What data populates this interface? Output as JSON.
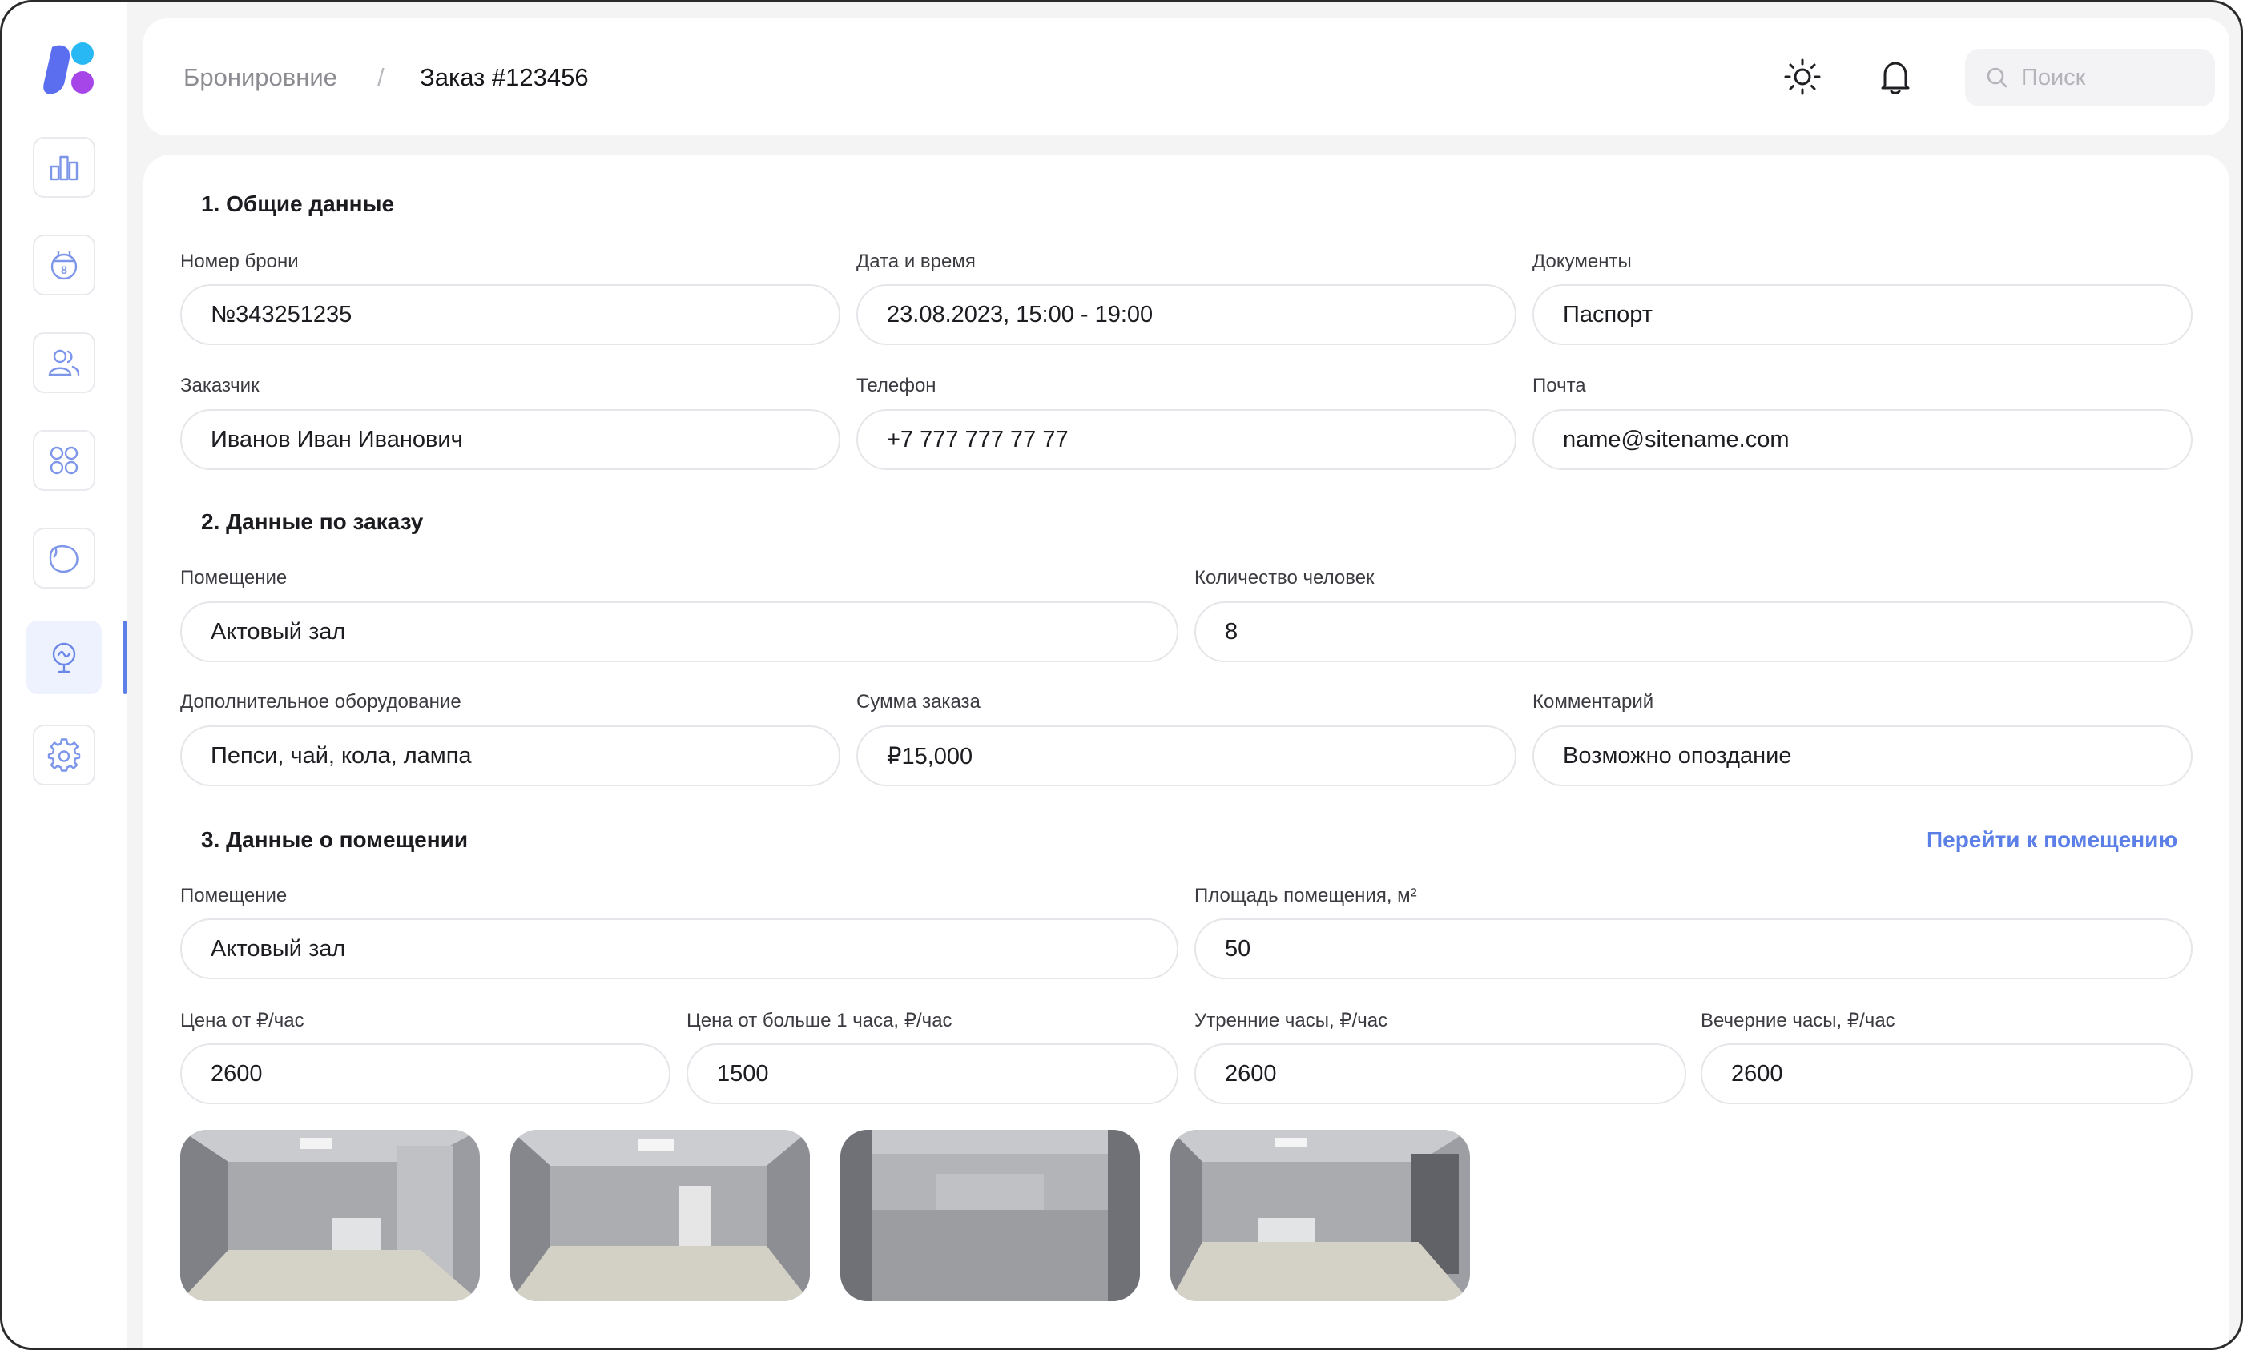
{
  "header": {
    "breadcrumb_root": "Бронировние",
    "breadcrumb_separator": "/",
    "breadcrumb_current": "Заказ #123456",
    "search_placeholder": "Поиск"
  },
  "sidebar": {
    "items": [
      {
        "icon": "bar-chart-icon"
      },
      {
        "icon": "calendar-icon",
        "badge": "8"
      },
      {
        "icon": "users-icon"
      },
      {
        "icon": "grid-icon"
      },
      {
        "icon": "blob-icon"
      },
      {
        "icon": "presentation-icon",
        "active": true
      },
      {
        "icon": "gear-icon"
      }
    ],
    "accent_color": "#5d7fe8"
  },
  "section1": {
    "title": "1. Общие данные",
    "fields": {
      "booking_number": {
        "label": "Номер брони",
        "value": "№343251235"
      },
      "datetime": {
        "label": "Дата и время",
        "value": "23.08.2023, 15:00 - 19:00"
      },
      "documents": {
        "label": "Документы",
        "value": "Паспорт"
      },
      "customer": {
        "label": "Заказчик",
        "value": "Иванов Иван Иванович"
      },
      "phone": {
        "label": "Телефон",
        "value": "+7 777 777 77 77"
      },
      "email": {
        "label": "Почта",
        "value": "name@sitename.com"
      }
    }
  },
  "section2": {
    "title": "2. Данные по заказу",
    "fields": {
      "room": {
        "label": "Помещение",
        "value": "Актовый зал"
      },
      "people": {
        "label": "Количество человек",
        "value": "8"
      },
      "equipment": {
        "label": "Дополнительное оборудование",
        "value": "Пепси, чай, кола, лампа"
      },
      "sum": {
        "label": "Сумма заказа",
        "value": "₽15,000"
      },
      "comment": {
        "label": "Комментарий",
        "value": "Возможно опоздание"
      }
    }
  },
  "section3": {
    "title": "3. Данные о помещении",
    "link_label": "Перейти к помещению",
    "fields": {
      "room": {
        "label": "Помещение",
        "value": "Актовый зал"
      },
      "area": {
        "label": "Площадь помещения, м²",
        "value": "50"
      },
      "price_from": {
        "label": "Цена от ₽/час",
        "value": "2600"
      },
      "price_more": {
        "label": "Цена от больше 1 часа, ₽/час",
        "value": "1500"
      },
      "morning": {
        "label": "Утренние часы, ₽/час",
        "value": "2600"
      },
      "evening": {
        "label": "Вечерние часы, ₽/час",
        "value": "2600"
      }
    },
    "photos_count": 4
  }
}
